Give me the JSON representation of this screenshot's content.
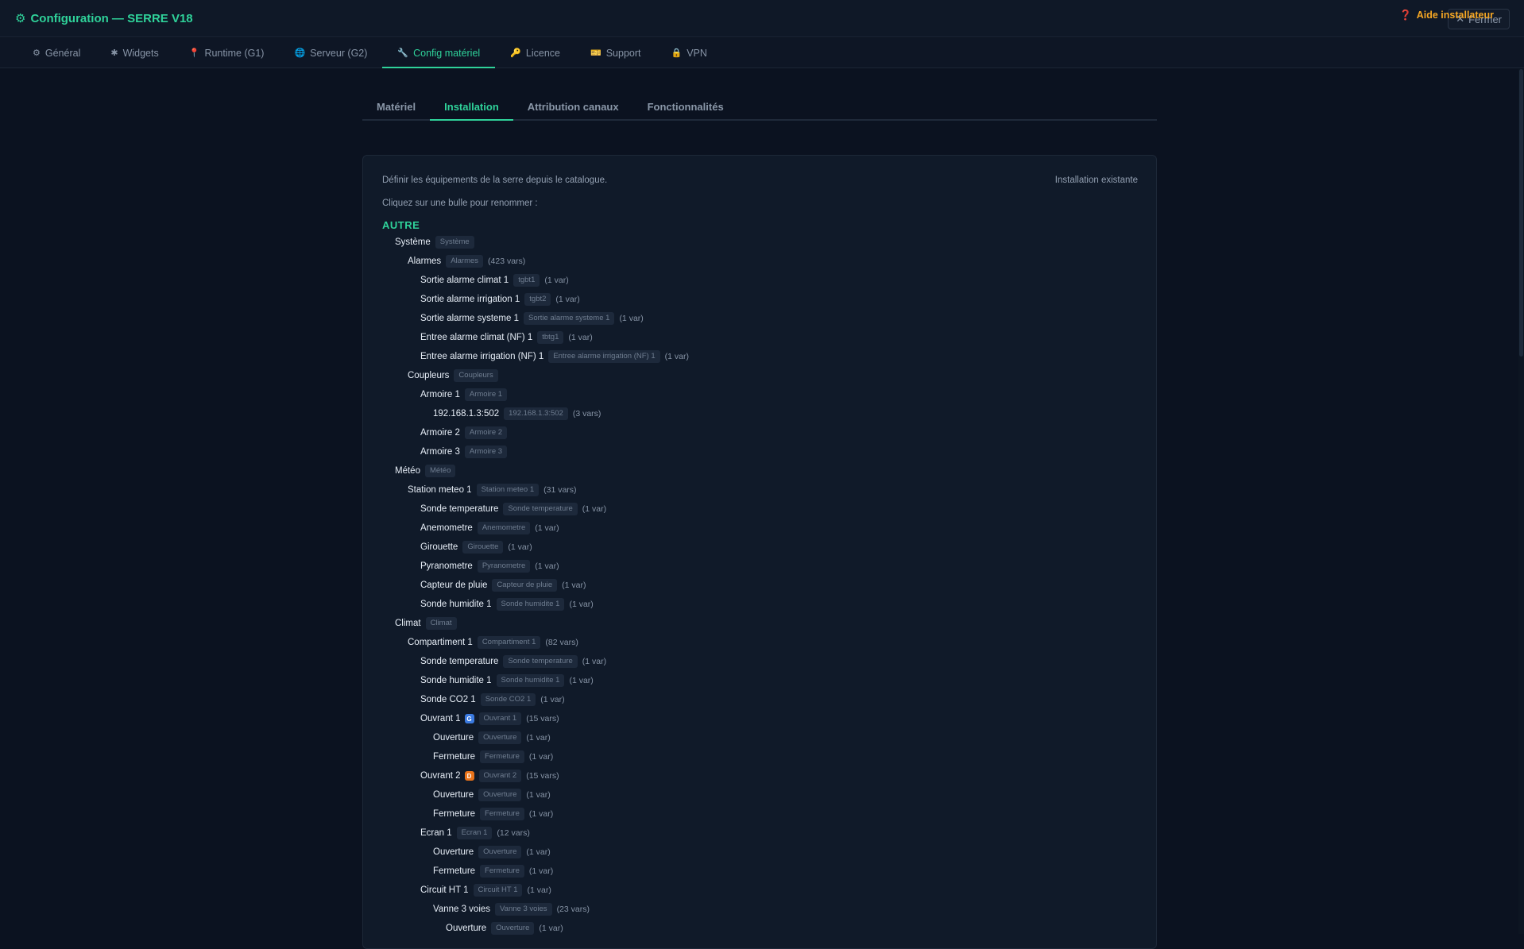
{
  "window": {
    "title": "Configuration — SERRE V18",
    "close_label": "Fermer"
  },
  "nav": {
    "tabs": [
      {
        "icon": "⚙",
        "label": "Général",
        "icon_name": "gear-icon"
      },
      {
        "icon": "✱",
        "label": "Widgets",
        "icon_name": "puzzle-icon"
      },
      {
        "icon": "📍",
        "label": "Runtime (G1)",
        "icon_name": "pin-icon"
      },
      {
        "icon": "🌐",
        "label": "Serveur (G2)",
        "icon_name": "globe-icon"
      },
      {
        "icon": "🔧",
        "label": "Config matériel",
        "icon_name": "wrench-icon",
        "active": true
      },
      {
        "icon": "🔑",
        "label": "Licence",
        "icon_name": "key-icon"
      },
      {
        "icon": "🎫",
        "label": "Support",
        "icon_name": "ticket-icon"
      },
      {
        "icon": "🔒",
        "label": "VPN",
        "icon_name": "lock-icon"
      }
    ],
    "help_label": "Aide installateur"
  },
  "subtabs": [
    "Matériel",
    "Installation",
    "Attribution canaux",
    "Fonctionnalités"
  ],
  "active_subtab": 1,
  "panel": {
    "description": "Définir les équipements de la serre depuis le catalogue.",
    "status": "Installation existante",
    "hint": "Cliquez sur une bulle pour renommer :",
    "section": "AUTRE"
  },
  "tree": [
    {
      "level": 1,
      "name": "Système",
      "chip": "Système"
    },
    {
      "level": 2,
      "name": "Alarmes",
      "chip": "Alarmes",
      "count": "(423 vars)"
    },
    {
      "level": 3,
      "name": "Sortie alarme climat 1",
      "chip": "tgbt1",
      "count": "(1 var)"
    },
    {
      "level": 3,
      "name": "Sortie alarme irrigation 1",
      "chip": "tgbt2",
      "count": "(1 var)"
    },
    {
      "level": 3,
      "name": "Sortie alarme systeme 1",
      "chip": "Sortie alarme systeme 1",
      "count": "(1 var)"
    },
    {
      "level": 3,
      "name": "Entree alarme climat (NF) 1",
      "chip": "tbtg1",
      "count": "(1 var)"
    },
    {
      "level": 3,
      "name": "Entree alarme irrigation (NF) 1",
      "chip": "Entree alarme irrigation (NF) 1",
      "count": "(1 var)"
    },
    {
      "level": 2,
      "name": "Coupleurs",
      "chip": "Coupleurs"
    },
    {
      "level": 3,
      "name": "Armoire 1",
      "chip": "Armoire 1"
    },
    {
      "level": 4,
      "name": "192.168.1.3:502",
      "chip": "192.168.1.3:502",
      "count": "(3 vars)"
    },
    {
      "level": 3,
      "name": "Armoire 2",
      "chip": "Armoire 2"
    },
    {
      "level": 3,
      "name": "Armoire 3",
      "chip": "Armoire 3"
    },
    {
      "level": 1,
      "name": "Météo",
      "chip": "Météo"
    },
    {
      "level": 2,
      "name": "Station meteo 1",
      "chip": "Station meteo 1",
      "count": "(31 vars)"
    },
    {
      "level": 3,
      "name": "Sonde temperature",
      "chip": "Sonde temperature",
      "count": "(1 var)"
    },
    {
      "level": 3,
      "name": "Anemometre",
      "chip": "Anemometre",
      "count": "(1 var)"
    },
    {
      "level": 3,
      "name": "Girouette",
      "chip": "Girouette",
      "count": "(1 var)"
    },
    {
      "level": 3,
      "name": "Pyranometre",
      "chip": "Pyranometre",
      "count": "(1 var)"
    },
    {
      "level": 3,
      "name": "Capteur de pluie",
      "chip": "Capteur de pluie",
      "count": "(1 var)"
    },
    {
      "level": 3,
      "name": "Sonde humidite 1",
      "chip": "Sonde humidite 1",
      "count": "(1 var)"
    },
    {
      "level": 1,
      "name": "Climat",
      "chip": "Climat"
    },
    {
      "level": 2,
      "name": "Compartiment 1",
      "chip": "Compartiment 1",
      "count": "(82 vars)"
    },
    {
      "level": 3,
      "name": "Sonde temperature",
      "chip": "Sonde temperature",
      "count": "(1 var)"
    },
    {
      "level": 3,
      "name": "Sonde humidite 1",
      "chip": "Sonde humidite 1",
      "count": "(1 var)"
    },
    {
      "level": 3,
      "name": "Sonde CO2 1",
      "chip": "Sonde CO2 1",
      "count": "(1 var)"
    },
    {
      "level": 3,
      "name": "Ouvrant 1",
      "badge": "G",
      "badge_color": "#3b7ae0",
      "chip": "Ouvrant 1",
      "count": "(15 vars)"
    },
    {
      "level": 4,
      "name": "Ouverture",
      "chip": "Ouverture",
      "count": "(1 var)"
    },
    {
      "level": 4,
      "name": "Fermeture",
      "chip": "Fermeture",
      "count": "(1 var)"
    },
    {
      "level": 3,
      "name": "Ouvrant 2",
      "badge": "D",
      "badge_color": "#e9731a",
      "chip": "Ouvrant 2",
      "count": "(15 vars)"
    },
    {
      "level": 4,
      "name": "Ouverture",
      "chip": "Ouverture",
      "count": "(1 var)"
    },
    {
      "level": 4,
      "name": "Fermeture",
      "chip": "Fermeture",
      "count": "(1 var)"
    },
    {
      "level": 3,
      "name": "Ecran 1",
      "chip": "Ecran 1",
      "count": "(12 vars)"
    },
    {
      "level": 4,
      "name": "Ouverture",
      "chip": "Ouverture",
      "count": "(1 var)"
    },
    {
      "level": 4,
      "name": "Fermeture",
      "chip": "Fermeture",
      "count": "(1 var)"
    },
    {
      "level": 3,
      "name": "Circuit HT 1",
      "chip": "Circuit HT 1",
      "count": "(1 var)"
    },
    {
      "level": 4,
      "name": "Vanne 3 voies",
      "chip": "Vanne 3 voies",
      "count": "(23 vars)"
    },
    {
      "level": 5,
      "name": "Ouverture",
      "chip": "Ouverture",
      "count": "(1 var)"
    }
  ]
}
